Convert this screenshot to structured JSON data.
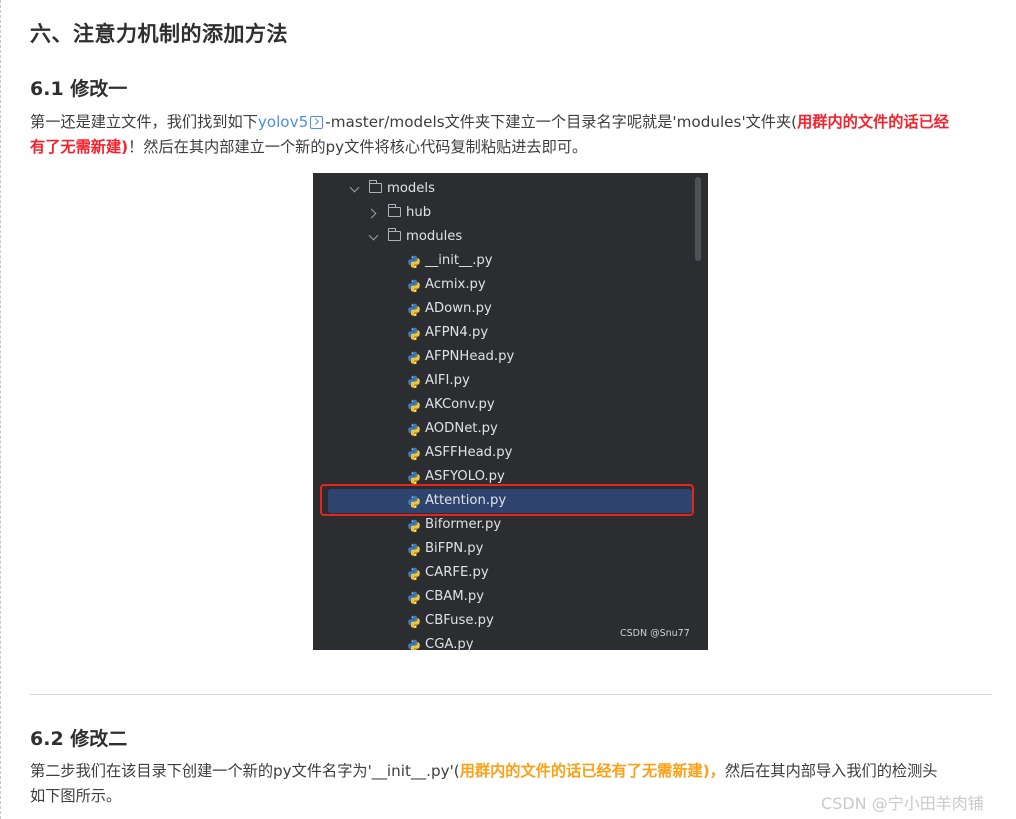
{
  "section_title": "六、注意力机制的添加方法",
  "s1": {
    "title": "6.1 修改一",
    "p_prefix": "第一还是建立文件，我们找到如下",
    "link_text": "yolov5",
    "p_mid": "-master/models文件夹下建立一个目录名字呢就是'modules'文件夹(",
    "red_line1": "用群内的文件的话已经",
    "red_line2": "有了无需新建)",
    "p_suffix": "！然后在其内部建立一个新的py文件将核心代码复制粘贴进去即可。"
  },
  "tree": {
    "root": "models",
    "hub": "hub",
    "modules": "modules",
    "files": [
      "__init__.py",
      "Acmix.py",
      "ADown.py",
      "AFPN4.py",
      "AFPNHead.py",
      "AIFI.py",
      "AKConv.py",
      "AODNet.py",
      "ASFFHead.py",
      "ASFYOLO.py",
      "Attention.py",
      "Biformer.py",
      "BiFPN.py",
      "CARFE.py",
      "CBAM.py",
      "CBFuse.py",
      "CGA.py"
    ],
    "selected": "Attention.py",
    "watermark": "CSDN @Snu77"
  },
  "s2": {
    "title": "6.2 修改二",
    "p_prefix": "第二步我们在该目录下创建一个新的py文件名字为'__init__.py'(",
    "orange": "用群内的文件的话已经有了无需新建)，",
    "p_suffix": "然后在其内部导入我们的检测头",
    "p_line2": "如下图所示。"
  },
  "page_watermark": "CSDN @宁小田羊肉铺",
  "colors": {
    "link": "#4a90e2",
    "red": "#f5222d",
    "orange": "#fca016",
    "ide_bg": "#2b2d30",
    "selection": "#2e436e",
    "highlight_box": "#e5251e"
  }
}
